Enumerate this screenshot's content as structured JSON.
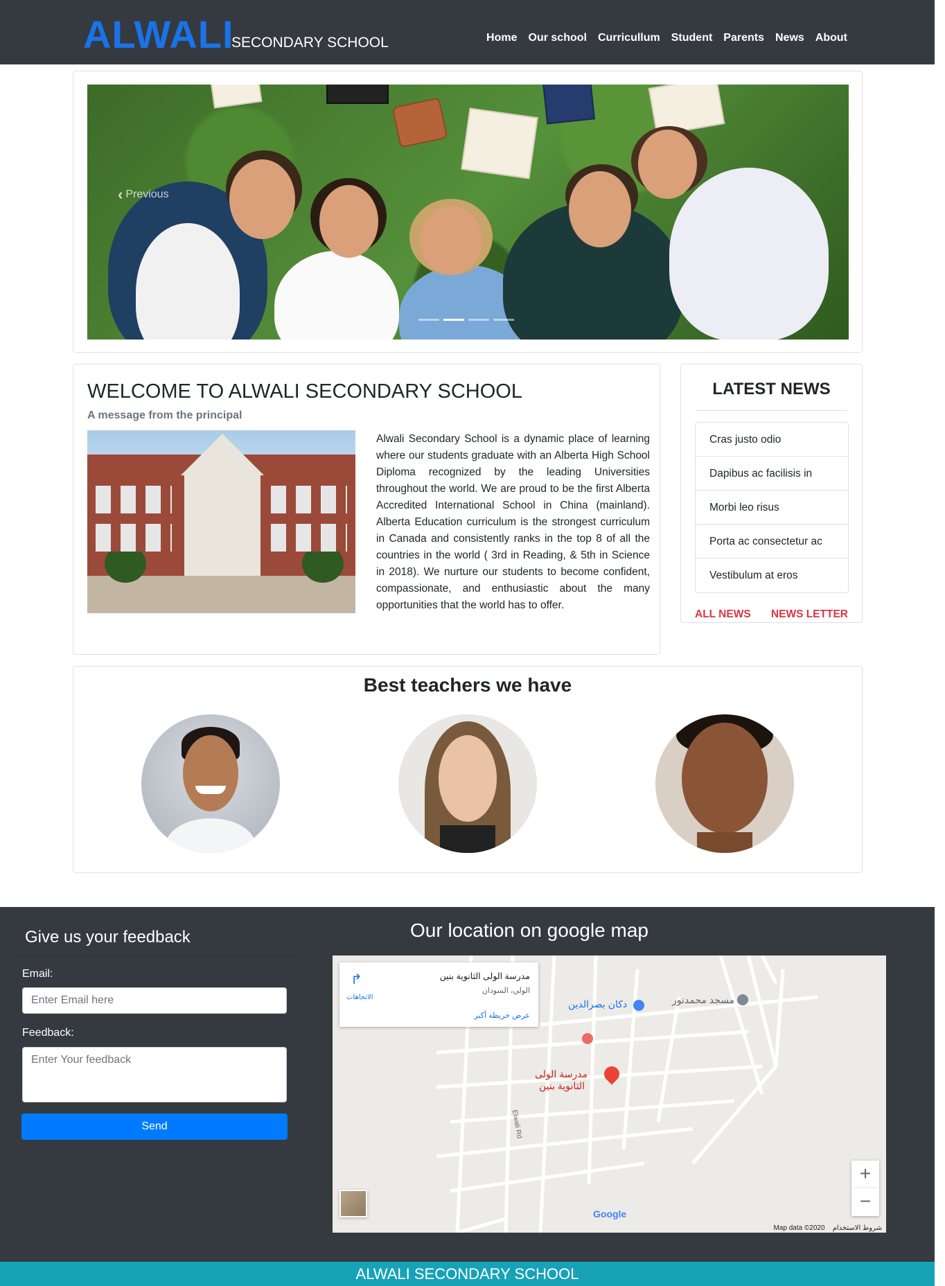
{
  "brand": {
    "name": "ALWALI",
    "subtitle": "SECONDARY SCHOOL"
  },
  "nav": {
    "items": [
      "Home",
      "Our school",
      "Curricullum",
      "Student",
      "Parents",
      "News",
      "About"
    ]
  },
  "carousel": {
    "prev_label": "Previous",
    "indicators": 4,
    "active_index": 1
  },
  "welcome": {
    "title": "WELCOME TO ALWALI SECONDARY SCHOOL",
    "subtitle": "A message from the principal",
    "body": "Alwali Secondary School is a dynamic place of learning where our students graduate with an Alberta High School Diploma recognized by the leading Universities throughout the world. We are proud to be the first Alberta Accredited International School in China (mainland). Alberta Education curriculum is the strongest curriculum in Canada and consistently ranks in the top 8 of all the countries in the world ( 3rd in Reading, & 5th in Science in 2018). We nurture our students to become confident, compassionate, and enthusiastic about the many opportunities that the world has to offer."
  },
  "news": {
    "title": "LATEST NEWS",
    "items": [
      "Cras justo odio",
      "Dapibus ac facilisis in",
      "Morbi leo risus",
      "Porta ac consectetur ac",
      "Vestibulum at eros"
    ],
    "all_news": "ALL NEWS",
    "newsletter": "NEWS LETTER"
  },
  "teachers": {
    "title": "Best teachers we have"
  },
  "feedback": {
    "title": "Give us your feedback",
    "email_label": "Email:",
    "email_placeholder": "Enter Email here",
    "feedback_label": "Feedback:",
    "feedback_placeholder": "Enter Your feedback",
    "send_label": "Send"
  },
  "map": {
    "title": "Our location on google map",
    "place_name": "مدرسة الولى الثانوية بنين",
    "place_address": "الولي، السودان",
    "larger_map": "عرض خريطة أكبر",
    "directions": "الاتجاهات",
    "poi_shop": "دكان بصرالدين",
    "poi_mosque": "مسجد محمدنور",
    "pin_label_1": "مدرسة الولى",
    "pin_label_2": "الثانوية بنين",
    "road": "Elwali Rd",
    "zoom_in": "+",
    "zoom_out": "−",
    "google": "Google",
    "map_data": "Map data ©2020",
    "terms": "شروط الاستخدام"
  },
  "footer": {
    "text": "ALWALI SECONDARY SCHOOL"
  },
  "colors": {
    "navbar": "#343a40",
    "brand": "#1a73e8",
    "accent_red": "#dc3545",
    "button": "#007bff",
    "footer_bar": "#17a2b8"
  }
}
